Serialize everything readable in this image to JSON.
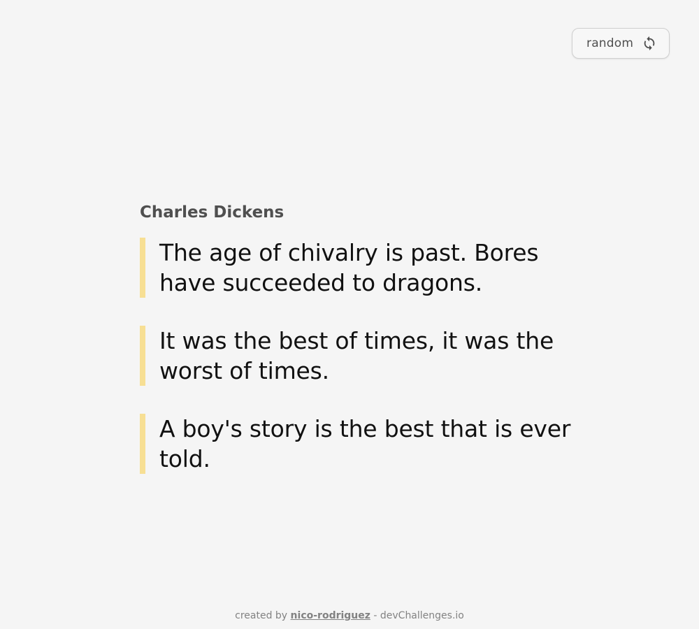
{
  "header": {
    "random_label": "random",
    "random_icon": "refresh-icon"
  },
  "author": "Charles Dickens",
  "quotes": [
    "The age of chivalry is past. Bores have succeeded to dragons.",
    "It was the best of times, it was the worst of times.",
    "A boy's story is the best that is ever told."
  ],
  "footer": {
    "prefix": "created by",
    "author_link": "nico-rodriguez",
    "suffix": "- devChallenges.io"
  },
  "colors": {
    "background": "#f5f5f5",
    "quote_accent": "#f7df94",
    "text_primary": "#111111",
    "text_secondary": "#4f4f4f",
    "footer_text": "#828282"
  }
}
